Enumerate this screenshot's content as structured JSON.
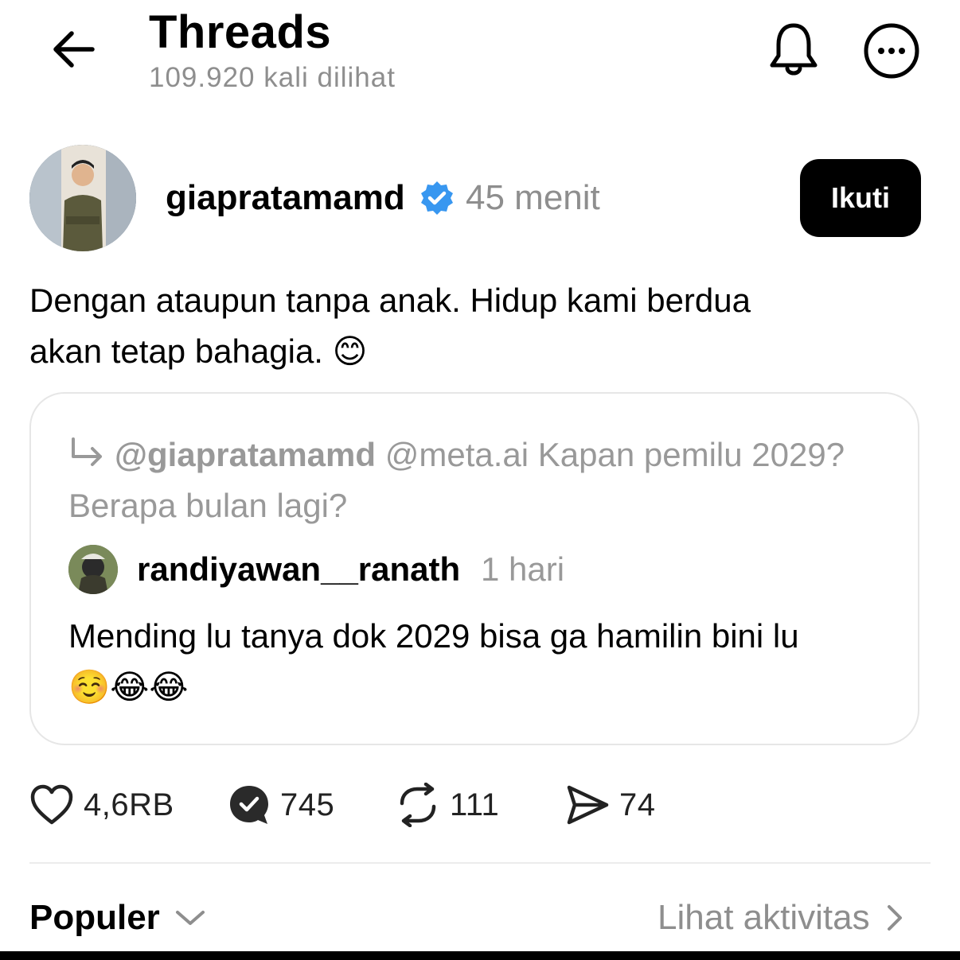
{
  "header": {
    "title": "Threads",
    "views": "109.920 kali dilihat"
  },
  "post": {
    "username": "giapratamamd",
    "time": "45 menit",
    "follow_label": "Ikuti",
    "text_line1": "Dengan ataupun tanpa anak.  Hidup kami berdua",
    "text_line2": "akan tetap bahagia.",
    "text_emoji": "😊"
  },
  "quote": {
    "reply_to_mention": "@giapratamamd",
    "reply_to_text": "@meta.ai Kapan pemilu 2029? Berapa bulan lagi?",
    "username": "randiyawan__ranath",
    "time": "1 hari",
    "text": "Mending lu tanya dok 2029 bisa ga hamilin bini lu",
    "emojis": "☺️😂😂"
  },
  "actions": {
    "likes": "4,6RB",
    "comments": "745",
    "reposts": "111",
    "shares": "74"
  },
  "footer": {
    "sort_label": "Populer",
    "activity_label": "Lihat aktivitas"
  },
  "colors": {
    "verified": "#3897f0",
    "muted_text": "#8e8e8e",
    "follow_button": "#000000"
  }
}
